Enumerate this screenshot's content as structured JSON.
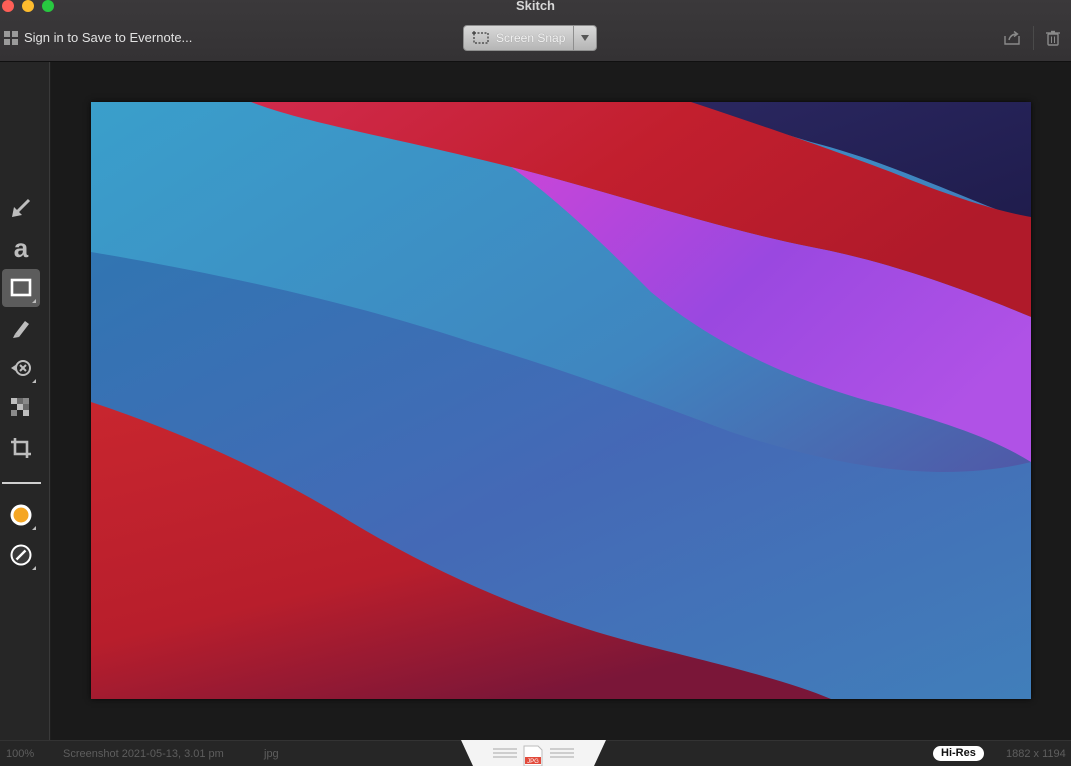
{
  "window": {
    "title": "Skitch"
  },
  "toolbar": {
    "signin_label": "Sign in to Save to Evernote...",
    "snap_label": "Screen Snap",
    "share_icon": "share-icon",
    "trash_icon": "trash-icon"
  },
  "tools": [
    {
      "name": "arrow-tool",
      "icon": "arrow-icon"
    },
    {
      "name": "text-tool",
      "icon": "text-a-icon",
      "glyph": "a"
    },
    {
      "name": "shape-tool",
      "icon": "rectangle-icon",
      "selected": true
    },
    {
      "name": "marker-tool",
      "icon": "marker-icon"
    },
    {
      "name": "stamp-tool",
      "icon": "stamp-icon"
    },
    {
      "name": "pixelate-tool",
      "icon": "pixelate-icon"
    },
    {
      "name": "crop-tool",
      "icon": "crop-icon"
    },
    {
      "name": "color-picker",
      "icon": "color-swatch-icon",
      "color": "#f5a623"
    },
    {
      "name": "stroke-picker",
      "icon": "stroke-width-icon"
    }
  ],
  "status": {
    "zoom": "100%",
    "filename": "Screenshot 2021-05-13, 3.01 pm",
    "format": "jpg",
    "drag_file_badge": "JPG",
    "hires_label": "Hi-Res",
    "dimensions": "1882 x 1194"
  },
  "colors": {
    "accent_orange": "#f5a623",
    "wall_blue": "#3d8fc4",
    "wall_red": "#c42235",
    "wall_purple": "#9a4ee0",
    "wall_navy": "#252356"
  }
}
